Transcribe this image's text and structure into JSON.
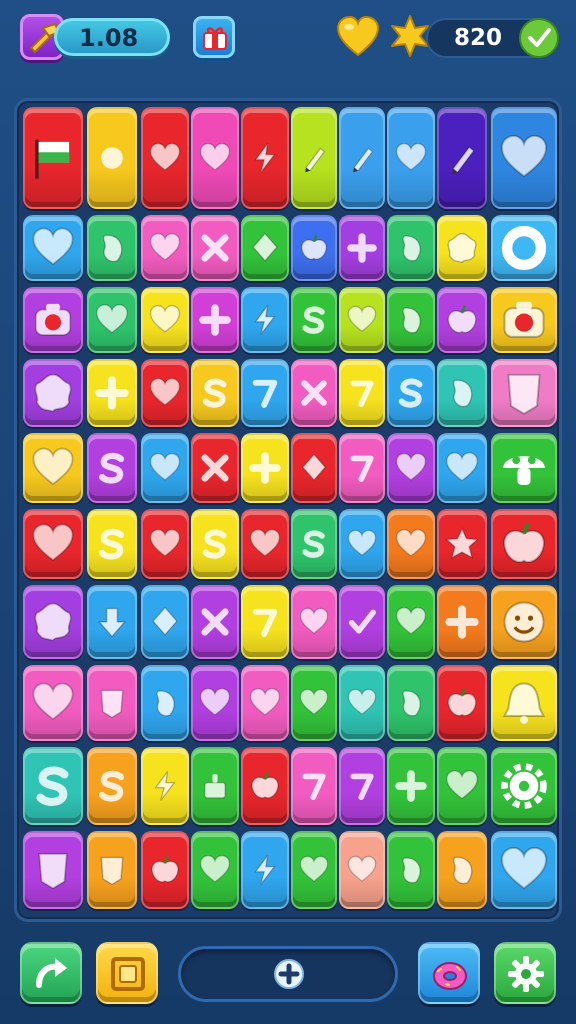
{
  "header": {
    "level_value": "1.08",
    "score_value": "820",
    "icons": [
      "hammer-tool-icon",
      "gift-box-icon",
      "heart-icon",
      "star-icon",
      "check-icon"
    ]
  },
  "board": {
    "rows": 10,
    "columns": 10,
    "tiles": [
      [
        {
          "color": "#e8262c",
          "icon": "flag-icon"
        },
        {
          "color": "#f7c81e",
          "icon": "swirl-icon"
        },
        {
          "color": "#e8262c",
          "icon": "heart-arrow-icon"
        },
        {
          "color": "#f04ab7",
          "icon": "heart-m-icon"
        },
        {
          "color": "#e8262c",
          "icon": "bolt-pencil-icon"
        },
        {
          "color": "#b6e21f",
          "icon": "gem-pencil-icon"
        },
        {
          "color": "#3aa0ee",
          "icon": "hand-pencil-icon"
        },
        {
          "color": "#3aa0ee",
          "icon": "heart-pencil-icon"
        },
        {
          "color": "#4c1fbf",
          "icon": "pencil-icon"
        },
        {
          "color": "#2f86e0",
          "icon": "heart-rainbow-icon"
        }
      ],
      [
        {
          "color": "#2fa6ee",
          "icon": "heart-icon"
        },
        {
          "color": "#2fc46b",
          "icon": "bean-icon"
        },
        {
          "color": "#f25cc0",
          "icon": "heart-icon"
        },
        {
          "color": "#f25cc0",
          "icon": "x-icon"
        },
        {
          "color": "#33c33a",
          "icon": "diamond-icon"
        },
        {
          "color": "#3d6ff0",
          "icon": "berry-icon"
        },
        {
          "color": "#a33fe0",
          "icon": "cross-icon"
        },
        {
          "color": "#2fc46b",
          "icon": "leaf-icon"
        },
        {
          "color": "#f7e21e",
          "icon": "splat-icon"
        },
        {
          "color": "#3fb7f5",
          "icon": "ring-icon"
        }
      ],
      [
        {
          "color": "#b23fe0",
          "icon": "camera-icon"
        },
        {
          "color": "#2fc46b",
          "icon": "heart-icon"
        },
        {
          "color": "#f7e21e",
          "icon": "heart-icon"
        },
        {
          "color": "#d23fd6",
          "icon": "cross-icon"
        },
        {
          "color": "#2fa6ee",
          "icon": "bolt-icon"
        },
        {
          "color": "#33c33a",
          "icon": "letter-k-icon"
        },
        {
          "color": "#b6e21f",
          "icon": "heart-icon"
        },
        {
          "color": "#33c33a",
          "icon": "pepper-icon"
        },
        {
          "color": "#b23fe0",
          "icon": "strawberry-icon"
        },
        {
          "color": "#f7c81e",
          "icon": "camera-icon"
        }
      ],
      [
        {
          "color": "#a33fe0",
          "icon": "splat-icon"
        },
        {
          "color": "#f7e21e",
          "icon": "plus-icon"
        },
        {
          "color": "#e8262c",
          "icon": "heart-icon"
        },
        {
          "color": "#f7c81e",
          "icon": "letter-j-icon"
        },
        {
          "color": "#2fa6ee",
          "icon": "seven-icon"
        },
        {
          "color": "#f25cc0",
          "icon": "x-icon"
        },
        {
          "color": "#f7e21e",
          "icon": "seven-icon"
        },
        {
          "color": "#2fa6ee",
          "icon": "letter-s-icon"
        },
        {
          "color": "#2fc4b4",
          "icon": "bean-icon"
        },
        {
          "color": "#f07cc6",
          "icon": "note-icon"
        }
      ],
      [
        {
          "color": "#f7c81e",
          "icon": "heart-icon"
        },
        {
          "color": "#b23fe0",
          "icon": "letter-s-icon"
        },
        {
          "color": "#2fa6ee",
          "icon": "heart-icon"
        },
        {
          "color": "#e8262c",
          "icon": "x-icon"
        },
        {
          "color": "#f7e21e",
          "icon": "plus-icon"
        },
        {
          "color": "#e8262c",
          "icon": "diamond-icon"
        },
        {
          "color": "#f25cc0",
          "icon": "seven-icon"
        },
        {
          "color": "#b23fe0",
          "icon": "heart-icon"
        },
        {
          "color": "#2fa6ee",
          "icon": "heart-icon"
        },
        {
          "color": "#33c33a",
          "icon": "mushroom-icon"
        }
      ],
      [
        {
          "color": "#e8262c",
          "icon": "heart-icon"
        },
        {
          "color": "#f7e21e",
          "icon": "letter-s-icon"
        },
        {
          "color": "#e8262c",
          "icon": "heart-icon"
        },
        {
          "color": "#f7e21e",
          "icon": "letter-c-icon"
        },
        {
          "color": "#e8262c",
          "icon": "heart-icon"
        },
        {
          "color": "#2fc46b",
          "icon": "letter-j-icon"
        },
        {
          "color": "#2fa6ee",
          "icon": "heart-icon"
        },
        {
          "color": "#f47a1e",
          "icon": "heart-icon"
        },
        {
          "color": "#e8262c",
          "icon": "star-icon"
        },
        {
          "color": "#e8262c",
          "icon": "apple-icon"
        }
      ],
      [
        {
          "color": "#a33fe0",
          "icon": "waffle-icon"
        },
        {
          "color": "#2fa6ee",
          "icon": "arrow-down-icon"
        },
        {
          "color": "#2fa6ee",
          "icon": "diamond-icon"
        },
        {
          "color": "#b23fe0",
          "icon": "x-icon"
        },
        {
          "color": "#f7e21e",
          "icon": "seven-icon"
        },
        {
          "color": "#f25cc0",
          "icon": "heart-icon"
        },
        {
          "color": "#b23fe0",
          "icon": "checkmark-icon"
        },
        {
          "color": "#33c33a",
          "icon": "heart-icon"
        },
        {
          "color": "#f47a1e",
          "icon": "cross-icon"
        },
        {
          "color": "#f7a21e",
          "icon": "smiley-icon"
        }
      ],
      [
        {
          "color": "#f25cc0",
          "icon": "heart-icon"
        },
        {
          "color": "#f25cc0",
          "icon": "card-icon"
        },
        {
          "color": "#2fa6ee",
          "icon": "leaf-icon"
        },
        {
          "color": "#b23fe0",
          "icon": "heart-icon"
        },
        {
          "color": "#f25cc0",
          "icon": "heart-icon"
        },
        {
          "color": "#33c33a",
          "icon": "heart-icon"
        },
        {
          "color": "#2fc4b4",
          "icon": "heart-icon"
        },
        {
          "color": "#2fc46b",
          "icon": "bean-icon"
        },
        {
          "color": "#e8262c",
          "icon": "apple-icon"
        },
        {
          "color": "#f7e21e",
          "icon": "bell-icon"
        }
      ],
      [
        {
          "color": "#2fc4b4",
          "icon": "letter-s-icon"
        },
        {
          "color": "#f7a21e",
          "icon": "letter-s-icon"
        },
        {
          "color": "#f7e21e",
          "icon": "bolt-icon"
        },
        {
          "color": "#33c33a",
          "icon": "cake-icon"
        },
        {
          "color": "#e8262c",
          "icon": "apple-icon"
        },
        {
          "color": "#f25cc0",
          "icon": "seven-icon"
        },
        {
          "color": "#b23fe0",
          "icon": "seven-icon"
        },
        {
          "color": "#33c33a",
          "icon": "cross-icon"
        },
        {
          "color": "#33c33a",
          "icon": "heart-icon"
        },
        {
          "color": "#33c33a",
          "icon": "gear-icon"
        }
      ],
      [
        {
          "color": "#b23fe0",
          "icon": "shield-icon"
        },
        {
          "color": "#f7a21e",
          "icon": "card-icon"
        },
        {
          "color": "#e8262c",
          "icon": "apple-icon"
        },
        {
          "color": "#33c33a",
          "icon": "heart-icon"
        },
        {
          "color": "#2fa6ee",
          "icon": "bolt-icon"
        },
        {
          "color": "#33c33a",
          "icon": "heart-icon"
        },
        {
          "color": "#f7a28c",
          "icon": "heart-icon"
        },
        {
          "color": "#33c33a",
          "icon": "pepper-icon"
        },
        {
          "color": "#f7a21e",
          "icon": "bean-icon"
        },
        {
          "color": "#2fa6ee",
          "icon": "heart-icon"
        }
      ]
    ]
  },
  "footer": {
    "buttons": [
      "undo-button",
      "frame-button",
      "add-button",
      "donut-button",
      "settings-button"
    ],
    "colors": {
      "undo": "#2fc46b",
      "frame": "#f7c81e",
      "donut": "#2fa6ee",
      "settings": "#33c33a"
    }
  }
}
